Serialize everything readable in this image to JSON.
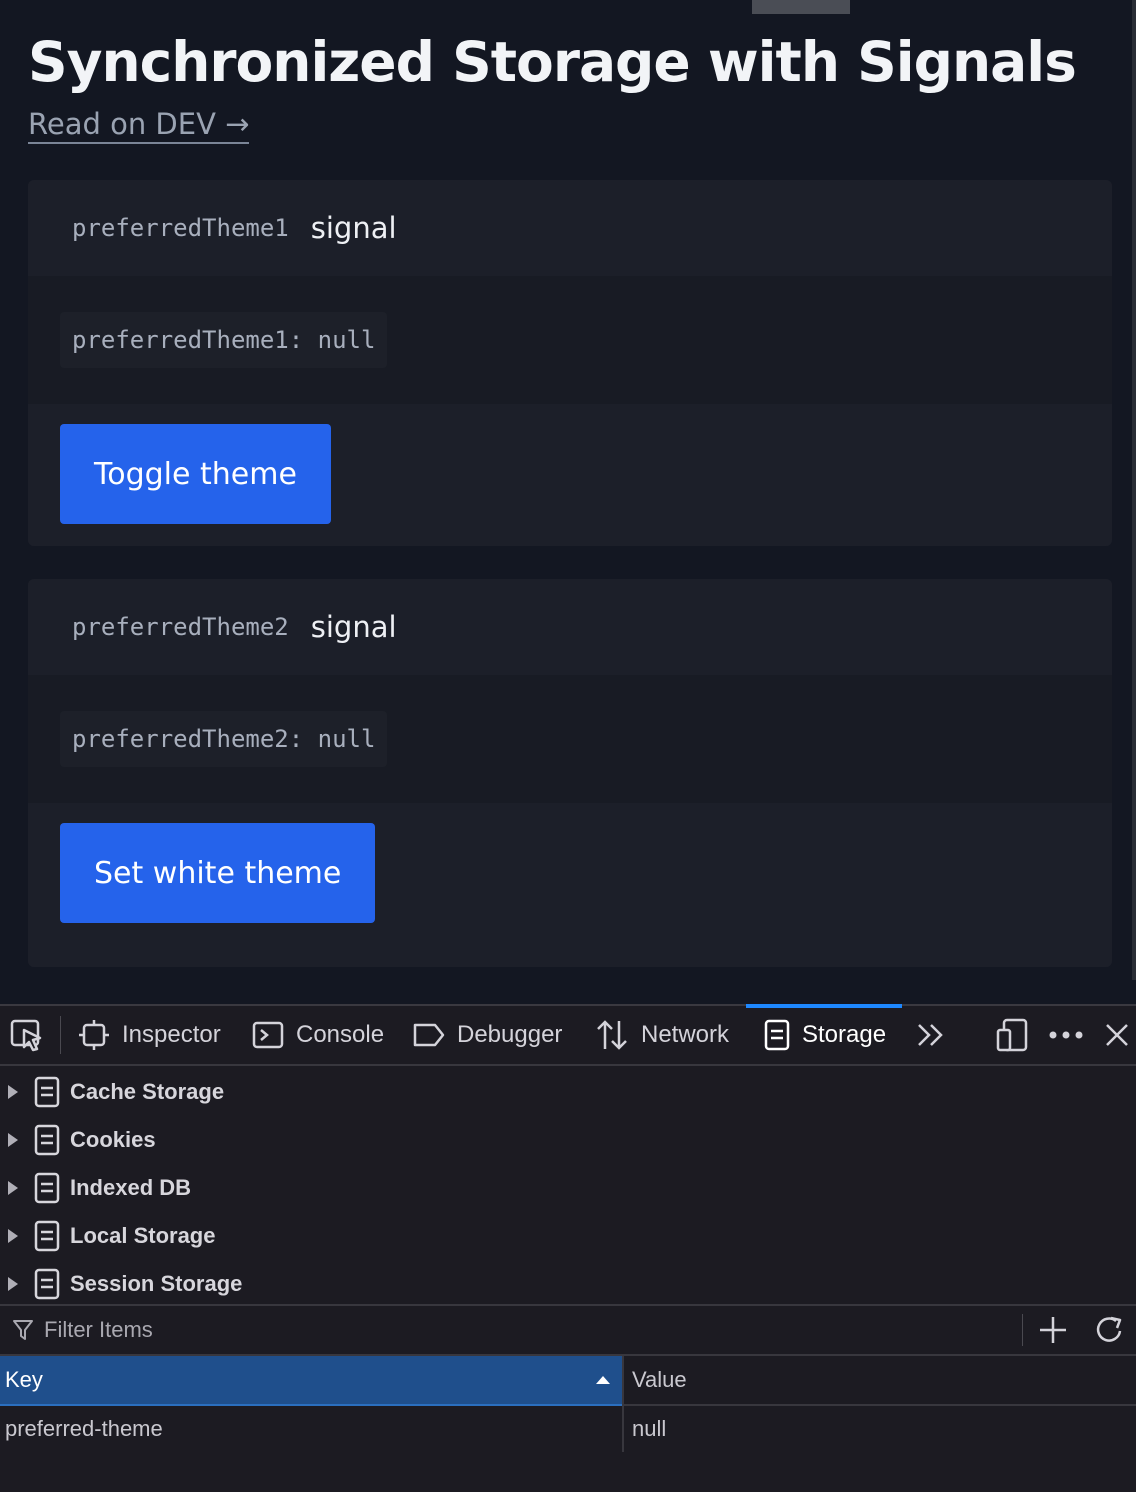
{
  "page": {
    "title": "Synchronized Storage with Signals",
    "link_text": "Read on DEV →"
  },
  "cards": [
    {
      "name": "preferredTheme1",
      "kind": "signal",
      "value_text": "preferredTheme1: null",
      "button_label": "Toggle theme"
    },
    {
      "name": "preferredTheme2",
      "kind": "signal",
      "value_text": "preferredTheme2: null",
      "button_label": "Set white theme"
    }
  ],
  "devtools": {
    "tabs": [
      {
        "label": "Inspector",
        "icon": "inspector-icon"
      },
      {
        "label": "Console",
        "icon": "console-icon"
      },
      {
        "label": "Debugger",
        "icon": "debugger-icon"
      },
      {
        "label": "Network",
        "icon": "network-icon"
      },
      {
        "label": "Storage",
        "icon": "storage-icon",
        "active": true
      }
    ],
    "tree": [
      {
        "label": "Cache Storage"
      },
      {
        "label": "Cookies"
      },
      {
        "label": "Indexed DB"
      },
      {
        "label": "Local Storage"
      },
      {
        "label": "Session Storage"
      }
    ],
    "filter_placeholder": "Filter Items",
    "table": {
      "columns": [
        "Key",
        "Value"
      ],
      "rows": [
        {
          "key": "preferred-theme",
          "value": "null"
        }
      ]
    }
  },
  "colors": {
    "accent": "#2563eb",
    "devtools_selected": "#1f4f8c",
    "active_tab": "#1e88ff"
  }
}
